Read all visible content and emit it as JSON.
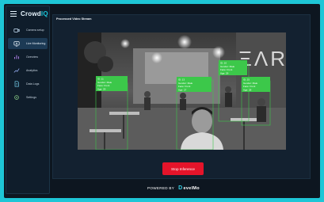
{
  "app": {
    "name_prefix": "Crowd",
    "name_accent": "IQ"
  },
  "sidebar": {
    "items": [
      {
        "label": "Camera setup",
        "icon": "camera-icon",
        "active": false
      },
      {
        "label": "Live Monitoring",
        "icon": "monitor-icon",
        "active": true
      },
      {
        "label": "Overview",
        "icon": "overview-icon",
        "active": false
      },
      {
        "label": "Analytics",
        "icon": "analytics-icon",
        "active": false
      },
      {
        "label": "Data Logs",
        "icon": "document-icon",
        "active": false
      },
      {
        "label": "Settings",
        "icon": "gear-icon",
        "active": false
      }
    ]
  },
  "main": {
    "title": "Processed Video Stream",
    "stop_button": "Stop Inference"
  },
  "detections": [
    {
      "lines": [
        "ID: 11",
        "Gender: Male",
        "Face: Front",
        "Age: 29"
      ]
    },
    {
      "lines": [
        "ID: 13",
        "Gender: Male",
        "Face: Front",
        "Age: 27"
      ]
    },
    {
      "lines": [
        "ID: 10",
        "Gender: Male",
        "Face: Front",
        "Age: 29"
      ]
    },
    {
      "lines": [
        "ID: 25",
        "Gender: Male",
        "Face: Front",
        "Age: 28"
      ]
    }
  ],
  "footer": {
    "powered_by": "POWERED BY",
    "brand": "evelMo"
  },
  "colors": {
    "accent": "#19c5da",
    "stop": "#e5142a",
    "detection": "#3cc84a"
  }
}
